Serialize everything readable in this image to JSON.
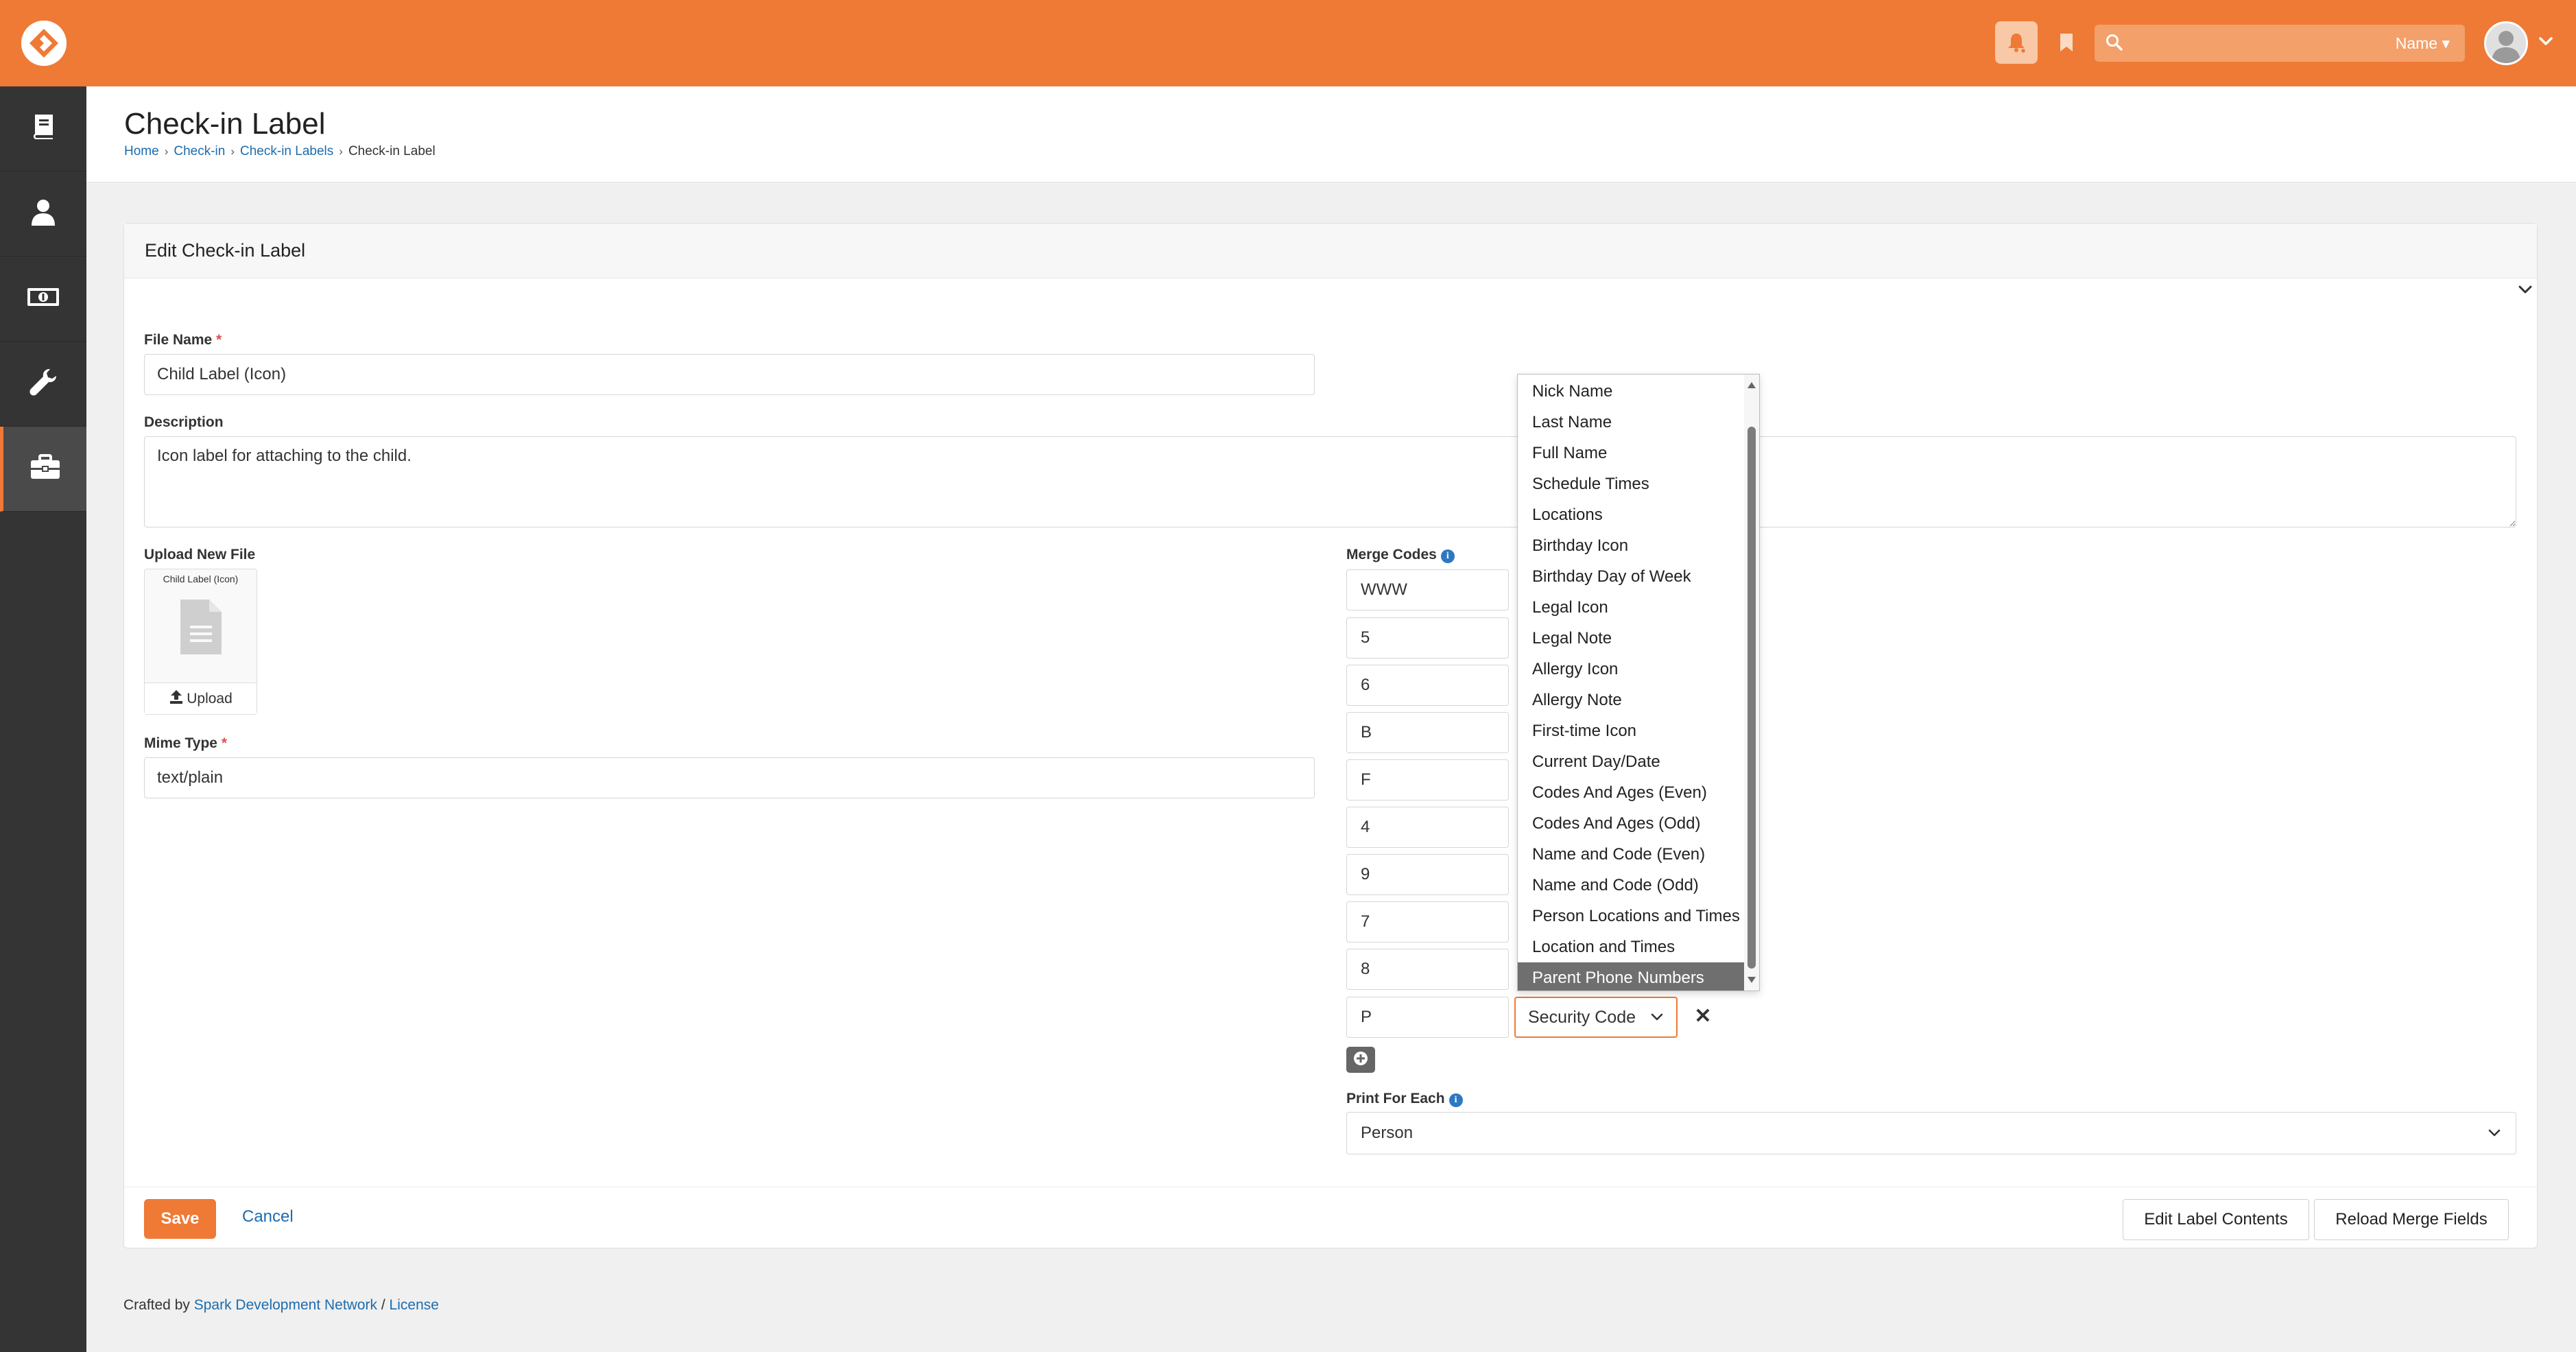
{
  "topbar": {
    "search_placeholder": "",
    "search_scope": "Name ▾"
  },
  "header": {
    "title": "Check-in Label",
    "breadcrumbs": [
      "Home",
      "Check-in",
      "Check-in Labels",
      "Check-in Label"
    ]
  },
  "panel": {
    "title": "Edit Check-in Label"
  },
  "form": {
    "file_name_label": "File Name",
    "required_mark": "*",
    "file_name_value": "Child Label (Icon)",
    "description_label": "Description",
    "description_value": "Icon label for attaching to the child.",
    "upload_label": "Upload New File",
    "upload_file_name": "Child Label (Icon)",
    "upload_button": "Upload",
    "mime_type_label": "Mime Type",
    "mime_type_value": "text/plain",
    "merge_codes_label": "Merge Codes",
    "info_icon_glyph": "i",
    "print_for_each_label": "Print For Each",
    "print_for_each_value": "Person"
  },
  "merge_codes": [
    {
      "code": "WWW"
    },
    {
      "code": "5"
    },
    {
      "code": "6"
    },
    {
      "code": "B"
    },
    {
      "code": "F"
    },
    {
      "code": "4"
    },
    {
      "code": "9"
    },
    {
      "code": "7"
    },
    {
      "code": "8"
    },
    {
      "code": "P",
      "field": "Security Code"
    }
  ],
  "remove_glyph": "✕",
  "dropdown_options": [
    "Nick Name",
    "Last Name",
    "Full Name",
    "Schedule Times",
    "Locations",
    "Birthday Icon",
    "Birthday Day of Week",
    "Legal Icon",
    "Legal Note",
    "Allergy Icon",
    "Allergy Note",
    "First-time Icon",
    "Current Day/Date",
    "Codes And Ages (Even)",
    "Codes And Ages (Odd)",
    "Name and Code (Even)",
    "Name and Code (Odd)",
    "Person Locations and Times",
    "Location and Times",
    "Parent Phone Numbers"
  ],
  "dropdown_highlighted": "Parent Phone Numbers",
  "buttons": {
    "save": "Save",
    "cancel": "Cancel",
    "edit_label_contents": "Edit Label Contents",
    "reload_merge_fields": "Reload Merge Fields"
  },
  "footer": {
    "crafted_by": "Crafted by",
    "org": "Spark Development Network",
    "separator": "/",
    "license": "License"
  },
  "colors": {
    "brand": "#ee7a36",
    "link": "#1c6cb0",
    "sidebar": "#343434"
  },
  "icons": {
    "sidebar": [
      "book-icon",
      "user-icon",
      "money-icon",
      "wrench-icon",
      "briefcase-icon"
    ]
  }
}
